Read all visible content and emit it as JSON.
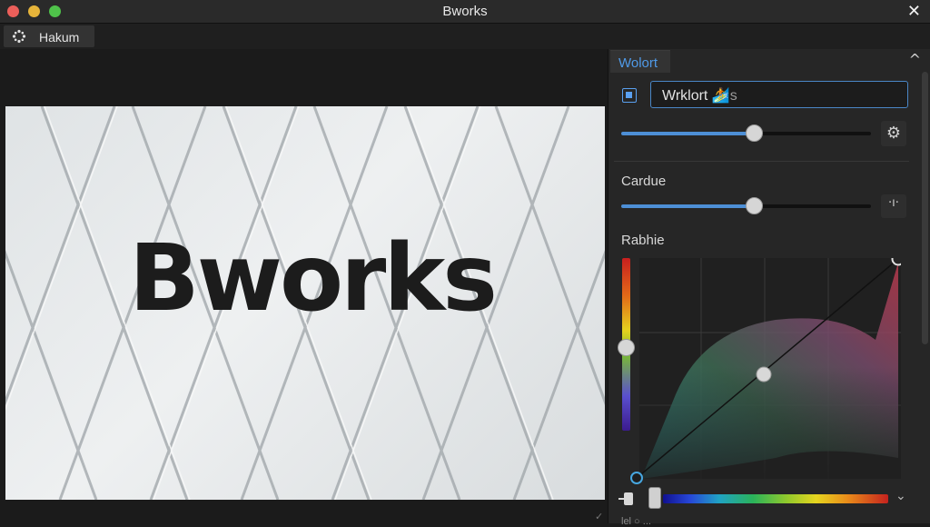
{
  "window": {
    "title": "Bworks"
  },
  "toolbar": {
    "tab_label": "Hakum"
  },
  "canvas": {
    "artwork_text": "Bworks"
  },
  "panel": {
    "tab_label": "Wolort",
    "name_field_value": "Wrklort",
    "name_field_suffix": "🏄s",
    "slider1_value": 0.53,
    "section1_label": "Cardue",
    "slider2_value": 0.53,
    "section2_label": "Rabhie",
    "curve_handle_value": 0.5,
    "bottom_text": "lel ○ ..."
  },
  "icons": {
    "close": "close-icon",
    "gear": "gear-icon",
    "collapse": "chevron-up-icon",
    "expand": "chevron-down-icon",
    "dots": "more-icon",
    "tool": "loader-icon"
  },
  "colors": {
    "accent": "#4f9ae8",
    "panel_bg": "#262626",
    "canvas_bg": "#1b1b1b"
  }
}
